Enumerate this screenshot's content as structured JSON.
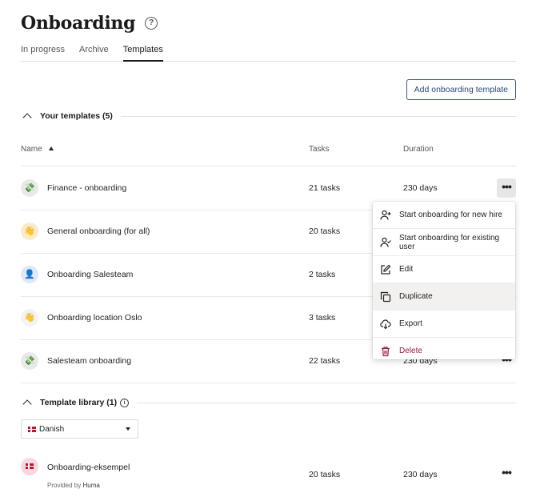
{
  "header": {
    "title": "Onboarding",
    "help_symbol": "?"
  },
  "tabs": [
    {
      "label": "In progress",
      "active": false
    },
    {
      "label": "Archive",
      "active": false
    },
    {
      "label": "Templates",
      "active": true
    }
  ],
  "actions": {
    "add_template_label": "Add onboarding template"
  },
  "your_templates": {
    "heading": "Your templates (5)",
    "columns": {
      "name": "Name",
      "tasks": "Tasks",
      "duration": "Duration"
    },
    "rows": [
      {
        "name": "Finance - onboarding",
        "tasks": "21 tasks",
        "duration": "230 days",
        "avatar_emoji": "💸"
      },
      {
        "name": "General onboarding (for all)",
        "tasks": "20 tasks",
        "duration": "",
        "avatar_emoji": "👋"
      },
      {
        "name": "Onboarding Salesteam",
        "tasks": "2 tasks",
        "duration": "",
        "avatar_emoji": "👤"
      },
      {
        "name": "Onboarding location Oslo",
        "tasks": "3 tasks",
        "duration": "",
        "avatar_emoji": "👋"
      },
      {
        "name": "Salesteam onboarding",
        "tasks": "22 tasks",
        "duration": "230 days",
        "avatar_emoji": "💸"
      }
    ]
  },
  "template_library": {
    "heading": "Template library (1)",
    "info_symbol": "i",
    "language": {
      "selected": "Danish"
    },
    "rows": [
      {
        "name": "Onboarding-eksempel",
        "provided_prefix": "Provided by",
        "provider": "Huma",
        "tasks": "20 tasks",
        "duration": "230 days"
      }
    ]
  },
  "context_menu": {
    "items": [
      {
        "label": "Start onboarding for new hire",
        "icon": "user-plus-icon"
      },
      {
        "label": "Start onboarding for existing user",
        "icon": "user-check-icon"
      },
      {
        "label": "Edit",
        "icon": "edit-icon"
      },
      {
        "label": "Duplicate",
        "icon": "duplicate-icon"
      },
      {
        "label": "Export",
        "icon": "cloud-download-icon"
      },
      {
        "label": "Delete",
        "icon": "trash-icon"
      }
    ]
  },
  "colors": {
    "accent": "#2a4a78",
    "danger": "#9b1c3c",
    "hover": "#f2f1ef"
  },
  "more_symbol": "•••"
}
